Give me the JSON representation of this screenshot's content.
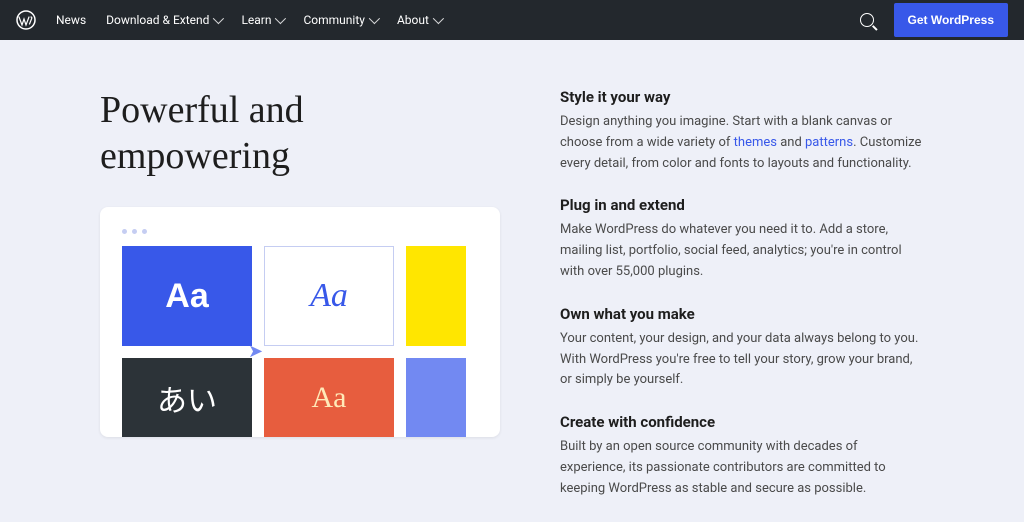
{
  "nav": {
    "items": [
      {
        "label": "News",
        "dd": false
      },
      {
        "label": "Download & Extend",
        "dd": true
      },
      {
        "label": "Learn",
        "dd": true
      },
      {
        "label": "Community",
        "dd": true
      },
      {
        "label": "About",
        "dd": true
      }
    ],
    "cta": "Get WordPress"
  },
  "headline": "Powerful and empowering",
  "tiles": {
    "t1": "Aa",
    "t2": "Aa",
    "t4": "あい",
    "t5": "Aa"
  },
  "sections": [
    {
      "h": "Style it your way",
      "p_pre": "Design anything you imagine. Start with a blank canvas or choose from a wide variety of ",
      "link1": "themes",
      "mid": " and ",
      "link2": "patterns",
      "p_post": ". Customize every detail, from color and fonts to layouts and functionality."
    },
    {
      "h": "Plug in and extend",
      "p": "Make WordPress do whatever you need it to. Add a store, mailing list, portfolio, social feed, analytics; you're in control with over 55,000 plugins."
    },
    {
      "h": "Own what you make",
      "p": "Your content, your design, and your data always belong to you. With WordPress you're free to tell your story, grow your brand, or simply be yourself."
    },
    {
      "h": "Create with confidence",
      "p": "Built by an open source community with decades of experience, its passionate contributors are committed to keeping WordPress as stable and secure as possible."
    }
  ]
}
